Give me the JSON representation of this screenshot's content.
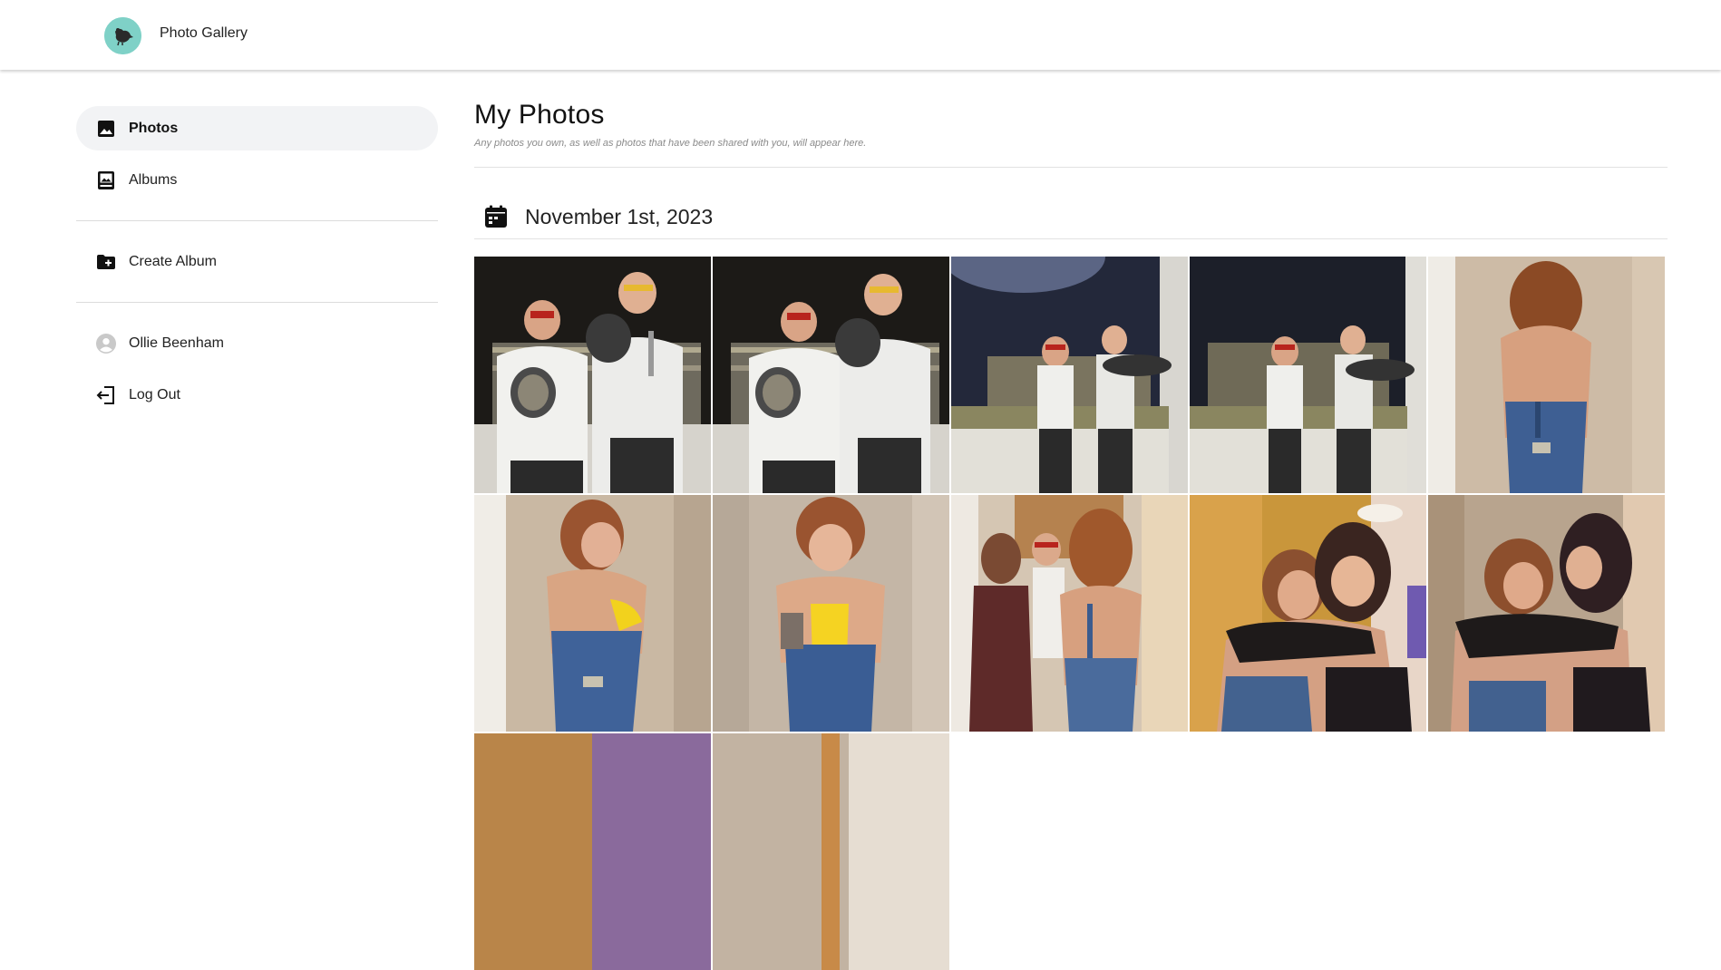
{
  "app": {
    "title": "Photo Gallery",
    "logo_icon": "bird-logo-icon",
    "logo_color": "#7fd1c7"
  },
  "sidebar": {
    "items": [
      {
        "label": "Photos",
        "icon": "image-icon",
        "active": true
      },
      {
        "label": "Albums",
        "icon": "album-icon",
        "active": false
      }
    ],
    "actions": [
      {
        "label": "Create Album",
        "icon": "folder-plus-icon"
      }
    ],
    "user": {
      "name": "Ollie Beenham",
      "icon": "user-avatar-icon"
    },
    "logout": {
      "label": "Log Out",
      "icon": "logout-icon"
    }
  },
  "main": {
    "title": "My Photos",
    "subtitle": "Any photos you own, as well as photos that have been shared with you, will appear here.",
    "groups": [
      {
        "date": "November 1st, 2023",
        "icon": "calendar-icon",
        "photos": [
          {
            "scene": "two chefs holding pans, dark background"
          },
          {
            "scene": "two chefs holding pans, dark background"
          },
          {
            "scene": "two chefs posing with pan, lit wall"
          },
          {
            "scene": "two chefs posing with pan, lit wall"
          },
          {
            "scene": "woman in overalls, hallway, from behind"
          },
          {
            "scene": "woman in overalls laughing, hallway"
          },
          {
            "scene": "woman in overalls smiling, hallway"
          },
          {
            "scene": "group in hallway doorway"
          },
          {
            "scene": "two women hugging"
          },
          {
            "scene": "two women hugging, kiss"
          },
          {
            "scene": "partially visible photo"
          },
          {
            "scene": "partially visible photo"
          }
        ]
      }
    ]
  }
}
